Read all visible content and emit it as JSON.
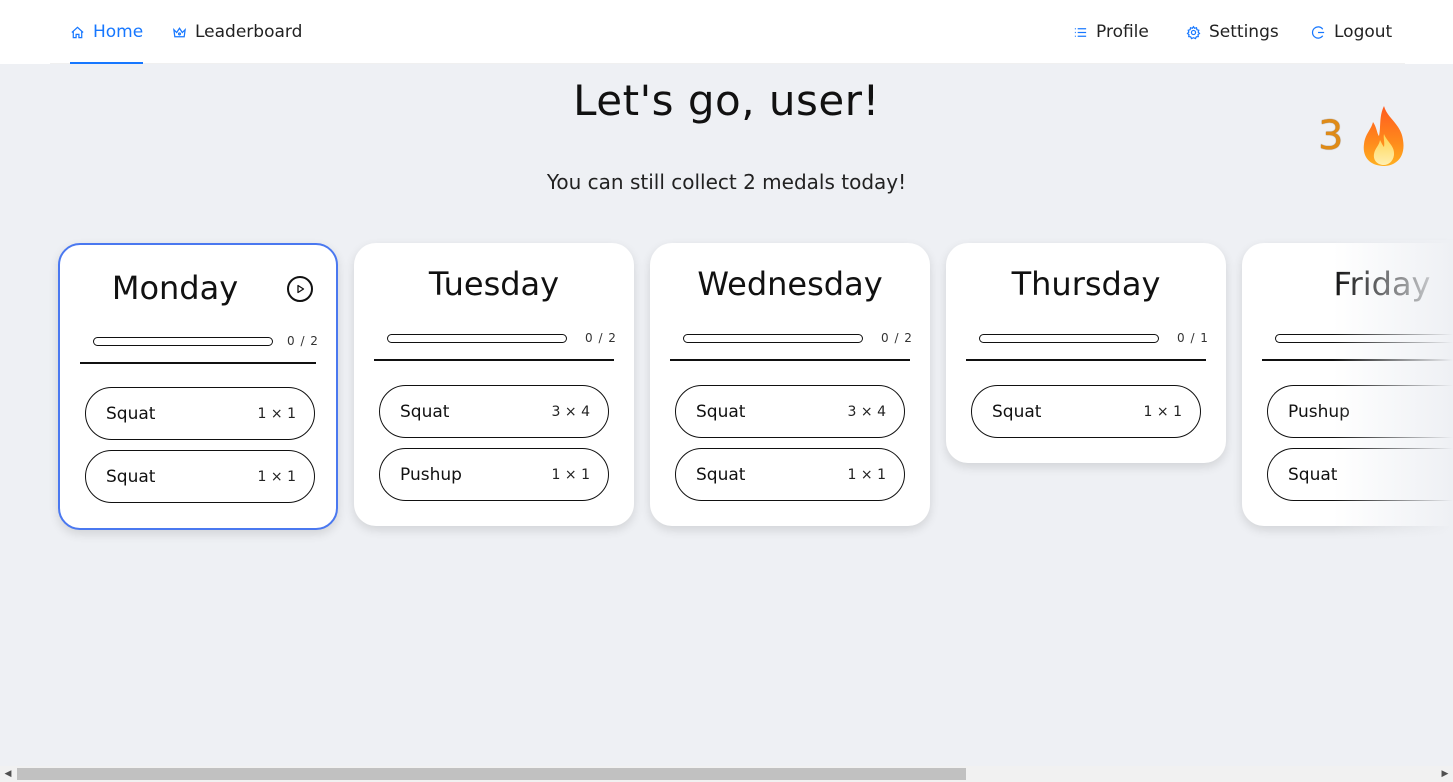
{
  "nav": {
    "home": "Home",
    "leaderboard": "Leaderboard",
    "profile": "Profile",
    "settings": "Settings",
    "logout": "Logout"
  },
  "greeting": "Let's go, user!",
  "subtitle": "You can still collect 2 medals today!",
  "streak": {
    "count": "3",
    "icon": "fire-icon"
  },
  "days": [
    {
      "name": "Monday",
      "progress": "0 / 2",
      "progress_fraction": 0,
      "selected": true,
      "exercises": [
        {
          "name": "Squat",
          "sets": "1 × 1"
        },
        {
          "name": "Squat",
          "sets": "1 × 1"
        }
      ]
    },
    {
      "name": "Tuesday",
      "progress": "0 / 2",
      "progress_fraction": 0,
      "exercises": [
        {
          "name": "Squat",
          "sets": "3 × 4"
        },
        {
          "name": "Pushup",
          "sets": "1 × 1"
        }
      ]
    },
    {
      "name": "Wednesday",
      "progress": "0 / 2",
      "progress_fraction": 0,
      "exercises": [
        {
          "name": "Squat",
          "sets": "3 × 4"
        },
        {
          "name": "Squat",
          "sets": "1 × 1"
        }
      ]
    },
    {
      "name": "Thursday",
      "progress": "0 / 1",
      "progress_fraction": 0,
      "exercises": [
        {
          "name": "Squat",
          "sets": "1 × 1"
        }
      ]
    },
    {
      "name": "Friday",
      "progress": "",
      "progress_fraction": 0,
      "exercises": [
        {
          "name": "Pushup",
          "sets": ""
        },
        {
          "name": "Squat",
          "sets": ""
        }
      ]
    }
  ],
  "colors": {
    "accent": "#1677ff",
    "selected_border": "#4a78f0",
    "streak": "#e08b16",
    "background": "#eef0f4"
  }
}
